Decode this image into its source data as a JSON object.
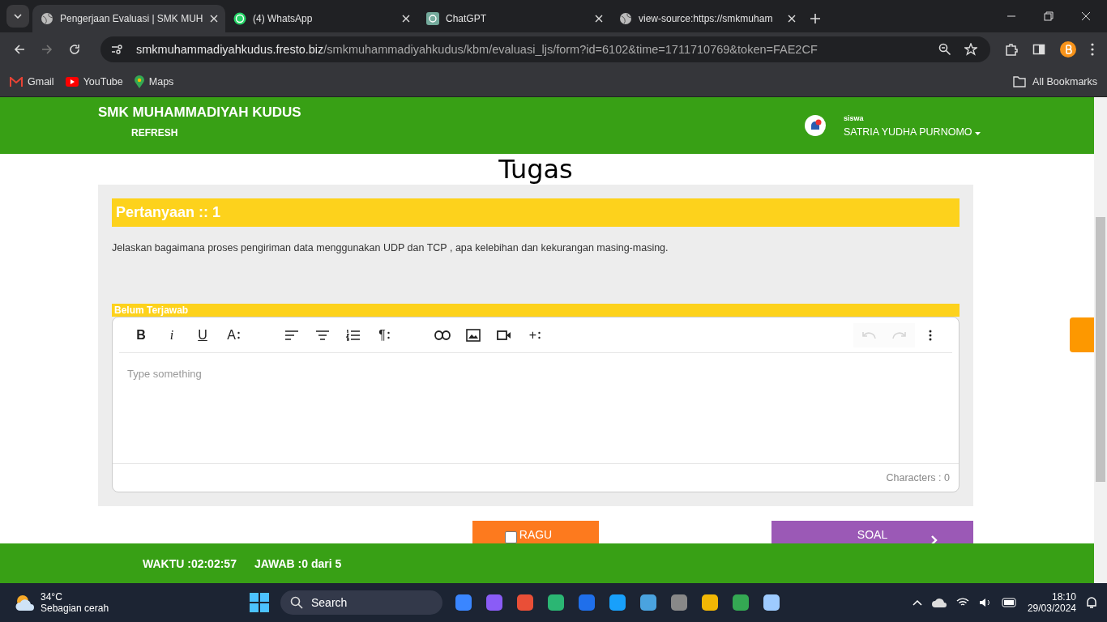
{
  "browser": {
    "tabs": [
      {
        "title": "Pengerjaan Evaluasi | SMK MUH",
        "kind": "globe",
        "selected": true
      },
      {
        "title": "(4) WhatsApp",
        "kind": "whatsapp",
        "selected": false
      },
      {
        "title": "ChatGPT",
        "kind": "chatgpt",
        "selected": false
      },
      {
        "title": "view-source:https://smkmuham",
        "kind": "globe",
        "selected": false
      }
    ],
    "url_host": "smkmuhammadiyahkudus.fresto.biz",
    "url_path": "/smkmuhammadiyahkudus/kbm/evaluasi_ljs/form?id=6102&time=1711710769&token=FAE2CF",
    "bookmarks": [
      {
        "label": "Gmail",
        "kind": "gmail"
      },
      {
        "label": "YouTube",
        "kind": "youtube"
      },
      {
        "label": "Maps",
        "kind": "maps"
      }
    ],
    "all_bookmarks": "All Bookmarks"
  },
  "header": {
    "school": "SMK MUHAMMADIYAH KUDUS",
    "refresh": "REFRESH",
    "role": "siswa",
    "user": "SATRIA YUDHA PURNOMO"
  },
  "heading": "Tugas",
  "question": {
    "label": "Pertanyaan :: 1",
    "text": "Jelaskan bagaimana proses pengiriman data menggunakan  UDP dan TCP , apa kelebihan dan kekurangan masing-masing.",
    "status": "Belum Terjawab"
  },
  "editor": {
    "toolbar": [
      {
        "kind": "bold",
        "label": "B",
        "disabled": false
      },
      {
        "kind": "italic",
        "label": "i",
        "disabled": false
      },
      {
        "kind": "underline",
        "label": "U",
        "disabled": false
      },
      {
        "kind": "size",
        "label": "A",
        "disabled": false
      },
      {
        "kind": "align-left",
        "disabled": false
      },
      {
        "kind": "align-center",
        "disabled": false
      },
      {
        "kind": "list",
        "disabled": false
      },
      {
        "kind": "paragraph",
        "label": "¶",
        "disabled": false
      },
      {
        "kind": "link",
        "disabled": false
      },
      {
        "kind": "image",
        "disabled": false
      },
      {
        "kind": "video",
        "disabled": false
      },
      {
        "kind": "insert",
        "label": "+",
        "disabled": false
      },
      {
        "kind": "undo",
        "disabled": true
      },
      {
        "kind": "redo",
        "disabled": true
      },
      {
        "kind": "more",
        "disabled": false
      }
    ],
    "placeholder": "Type something",
    "char_count": "Characters : 0"
  },
  "ragu": {
    "label": "RAGU",
    "checked": false
  },
  "soal": {
    "label": "SOAL"
  },
  "footer": {
    "timer": "WAKTU :02:02:57",
    "answered": "JAWAB :0 dari 5"
  },
  "taskbar": {
    "temperature": "34°C",
    "weather": "Sebagian cerah",
    "search": "Search",
    "time": "18:10",
    "date": "29/03/2024"
  }
}
